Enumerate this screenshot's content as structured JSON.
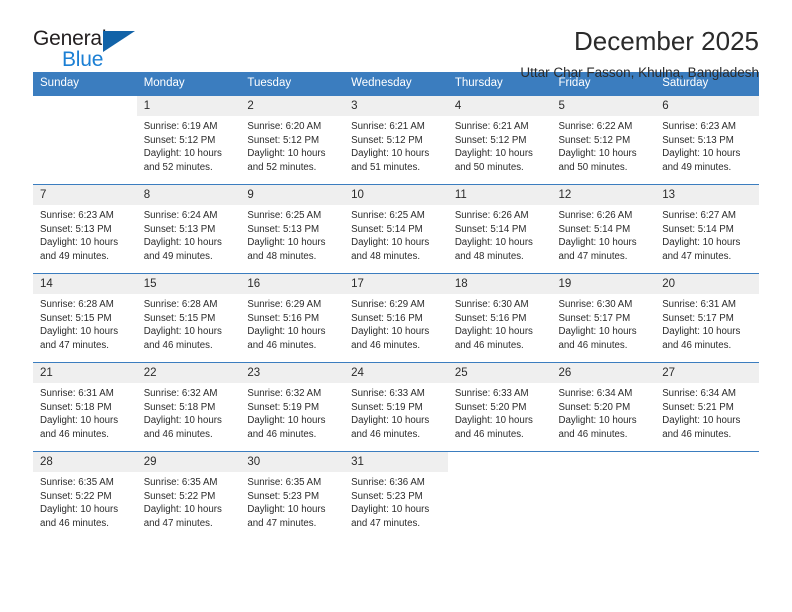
{
  "brand": {
    "name_top": "General",
    "name_bottom": "Blue",
    "triangle_color": "#1263a8",
    "blue_text_color": "#1b7fd4"
  },
  "header": {
    "title": "December 2025",
    "subtitle": "Uttar Char Fasson, Khulna, Bangladesh"
  },
  "theme": {
    "header_blue": "#3b7dbf",
    "daynum_band": "#efefef",
    "text": "#2b2b2b"
  },
  "weekdays": [
    "Sunday",
    "Monday",
    "Tuesday",
    "Wednesday",
    "Thursday",
    "Friday",
    "Saturday"
  ],
  "weeks": [
    [
      {
        "day": "",
        "sunrise": "",
        "sunset": "",
        "daylight1": "",
        "daylight2": ""
      },
      {
        "day": "1",
        "sunrise": "Sunrise: 6:19 AM",
        "sunset": "Sunset: 5:12 PM",
        "daylight1": "Daylight: 10 hours",
        "daylight2": "and 52 minutes."
      },
      {
        "day": "2",
        "sunrise": "Sunrise: 6:20 AM",
        "sunset": "Sunset: 5:12 PM",
        "daylight1": "Daylight: 10 hours",
        "daylight2": "and 52 minutes."
      },
      {
        "day": "3",
        "sunrise": "Sunrise: 6:21 AM",
        "sunset": "Sunset: 5:12 PM",
        "daylight1": "Daylight: 10 hours",
        "daylight2": "and 51 minutes."
      },
      {
        "day": "4",
        "sunrise": "Sunrise: 6:21 AM",
        "sunset": "Sunset: 5:12 PM",
        "daylight1": "Daylight: 10 hours",
        "daylight2": "and 50 minutes."
      },
      {
        "day": "5",
        "sunrise": "Sunrise: 6:22 AM",
        "sunset": "Sunset: 5:12 PM",
        "daylight1": "Daylight: 10 hours",
        "daylight2": "and 50 minutes."
      },
      {
        "day": "6",
        "sunrise": "Sunrise: 6:23 AM",
        "sunset": "Sunset: 5:13 PM",
        "daylight1": "Daylight: 10 hours",
        "daylight2": "and 49 minutes."
      }
    ],
    [
      {
        "day": "7",
        "sunrise": "Sunrise: 6:23 AM",
        "sunset": "Sunset: 5:13 PM",
        "daylight1": "Daylight: 10 hours",
        "daylight2": "and 49 minutes."
      },
      {
        "day": "8",
        "sunrise": "Sunrise: 6:24 AM",
        "sunset": "Sunset: 5:13 PM",
        "daylight1": "Daylight: 10 hours",
        "daylight2": "and 49 minutes."
      },
      {
        "day": "9",
        "sunrise": "Sunrise: 6:25 AM",
        "sunset": "Sunset: 5:13 PM",
        "daylight1": "Daylight: 10 hours",
        "daylight2": "and 48 minutes."
      },
      {
        "day": "10",
        "sunrise": "Sunrise: 6:25 AM",
        "sunset": "Sunset: 5:14 PM",
        "daylight1": "Daylight: 10 hours",
        "daylight2": "and 48 minutes."
      },
      {
        "day": "11",
        "sunrise": "Sunrise: 6:26 AM",
        "sunset": "Sunset: 5:14 PM",
        "daylight1": "Daylight: 10 hours",
        "daylight2": "and 48 minutes."
      },
      {
        "day": "12",
        "sunrise": "Sunrise: 6:26 AM",
        "sunset": "Sunset: 5:14 PM",
        "daylight1": "Daylight: 10 hours",
        "daylight2": "and 47 minutes."
      },
      {
        "day": "13",
        "sunrise": "Sunrise: 6:27 AM",
        "sunset": "Sunset: 5:14 PM",
        "daylight1": "Daylight: 10 hours",
        "daylight2": "and 47 minutes."
      }
    ],
    [
      {
        "day": "14",
        "sunrise": "Sunrise: 6:28 AM",
        "sunset": "Sunset: 5:15 PM",
        "daylight1": "Daylight: 10 hours",
        "daylight2": "and 47 minutes."
      },
      {
        "day": "15",
        "sunrise": "Sunrise: 6:28 AM",
        "sunset": "Sunset: 5:15 PM",
        "daylight1": "Daylight: 10 hours",
        "daylight2": "and 46 minutes."
      },
      {
        "day": "16",
        "sunrise": "Sunrise: 6:29 AM",
        "sunset": "Sunset: 5:16 PM",
        "daylight1": "Daylight: 10 hours",
        "daylight2": "and 46 minutes."
      },
      {
        "day": "17",
        "sunrise": "Sunrise: 6:29 AM",
        "sunset": "Sunset: 5:16 PM",
        "daylight1": "Daylight: 10 hours",
        "daylight2": "and 46 minutes."
      },
      {
        "day": "18",
        "sunrise": "Sunrise: 6:30 AM",
        "sunset": "Sunset: 5:16 PM",
        "daylight1": "Daylight: 10 hours",
        "daylight2": "and 46 minutes."
      },
      {
        "day": "19",
        "sunrise": "Sunrise: 6:30 AM",
        "sunset": "Sunset: 5:17 PM",
        "daylight1": "Daylight: 10 hours",
        "daylight2": "and 46 minutes."
      },
      {
        "day": "20",
        "sunrise": "Sunrise: 6:31 AM",
        "sunset": "Sunset: 5:17 PM",
        "daylight1": "Daylight: 10 hours",
        "daylight2": "and 46 minutes."
      }
    ],
    [
      {
        "day": "21",
        "sunrise": "Sunrise: 6:31 AM",
        "sunset": "Sunset: 5:18 PM",
        "daylight1": "Daylight: 10 hours",
        "daylight2": "and 46 minutes."
      },
      {
        "day": "22",
        "sunrise": "Sunrise: 6:32 AM",
        "sunset": "Sunset: 5:18 PM",
        "daylight1": "Daylight: 10 hours",
        "daylight2": "and 46 minutes."
      },
      {
        "day": "23",
        "sunrise": "Sunrise: 6:32 AM",
        "sunset": "Sunset: 5:19 PM",
        "daylight1": "Daylight: 10 hours",
        "daylight2": "and 46 minutes."
      },
      {
        "day": "24",
        "sunrise": "Sunrise: 6:33 AM",
        "sunset": "Sunset: 5:19 PM",
        "daylight1": "Daylight: 10 hours",
        "daylight2": "and 46 minutes."
      },
      {
        "day": "25",
        "sunrise": "Sunrise: 6:33 AM",
        "sunset": "Sunset: 5:20 PM",
        "daylight1": "Daylight: 10 hours",
        "daylight2": "and 46 minutes."
      },
      {
        "day": "26",
        "sunrise": "Sunrise: 6:34 AM",
        "sunset": "Sunset: 5:20 PM",
        "daylight1": "Daylight: 10 hours",
        "daylight2": "and 46 minutes."
      },
      {
        "day": "27",
        "sunrise": "Sunrise: 6:34 AM",
        "sunset": "Sunset: 5:21 PM",
        "daylight1": "Daylight: 10 hours",
        "daylight2": "and 46 minutes."
      }
    ],
    [
      {
        "day": "28",
        "sunrise": "Sunrise: 6:35 AM",
        "sunset": "Sunset: 5:22 PM",
        "daylight1": "Daylight: 10 hours",
        "daylight2": "and 46 minutes."
      },
      {
        "day": "29",
        "sunrise": "Sunrise: 6:35 AM",
        "sunset": "Sunset: 5:22 PM",
        "daylight1": "Daylight: 10 hours",
        "daylight2": "and 47 minutes."
      },
      {
        "day": "30",
        "sunrise": "Sunrise: 6:35 AM",
        "sunset": "Sunset: 5:23 PM",
        "daylight1": "Daylight: 10 hours",
        "daylight2": "and 47 minutes."
      },
      {
        "day": "31",
        "sunrise": "Sunrise: 6:36 AM",
        "sunset": "Sunset: 5:23 PM",
        "daylight1": "Daylight: 10 hours",
        "daylight2": "and 47 minutes."
      },
      {
        "day": "",
        "sunrise": "",
        "sunset": "",
        "daylight1": "",
        "daylight2": ""
      },
      {
        "day": "",
        "sunrise": "",
        "sunset": "",
        "daylight1": "",
        "daylight2": ""
      },
      {
        "day": "",
        "sunrise": "",
        "sunset": "",
        "daylight1": "",
        "daylight2": ""
      }
    ]
  ]
}
